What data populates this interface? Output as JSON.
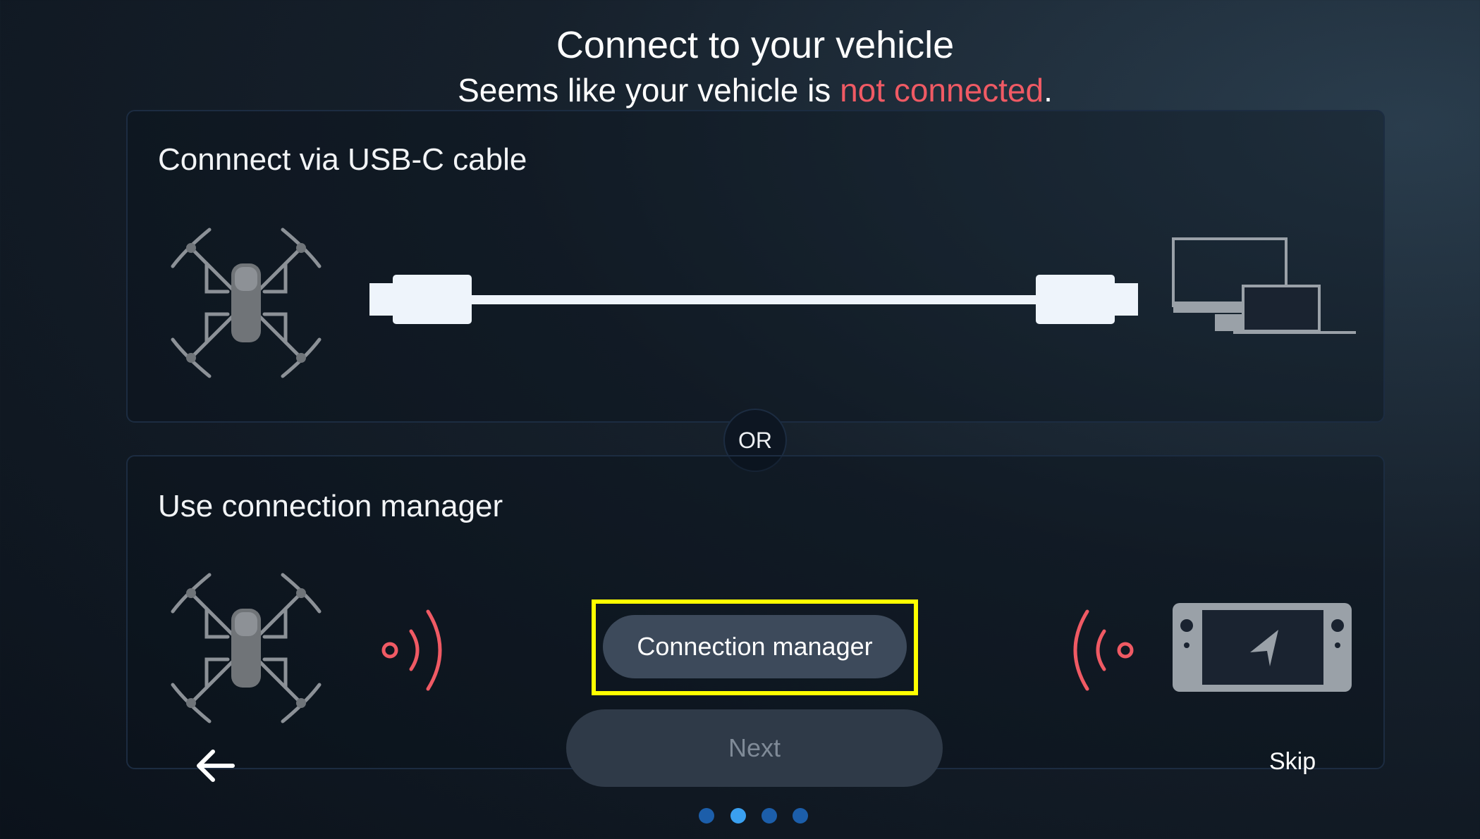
{
  "header": {
    "title": "Connect to your vehicle",
    "subtitle_prefix": "Seems like your vehicle is ",
    "subtitle_status": "not connected",
    "subtitle_suffix": "."
  },
  "usb_card": {
    "label": "Connnect via USB-C cable",
    "illustrations": [
      "drone-icon",
      "usb-c-cable-icon",
      "desktop-and-laptop-icon"
    ]
  },
  "divider": {
    "label": "OR"
  },
  "manager_card": {
    "label": "Use connection manager",
    "illustrations": [
      "drone-icon",
      "signal-waves-icon",
      "signal-waves-icon",
      "controller-icon"
    ]
  },
  "buttons": {
    "connection_manager": "Connection manager",
    "next": "Next",
    "skip": "Skip",
    "back": "back-arrow-icon"
  },
  "pagination": {
    "total": 4,
    "current": 2
  },
  "colors": {
    "status_red": "#f05a64",
    "highlight": "#ffff00",
    "dot_active": "#3aa0f0",
    "dot_inactive": "#1c5eaa"
  }
}
